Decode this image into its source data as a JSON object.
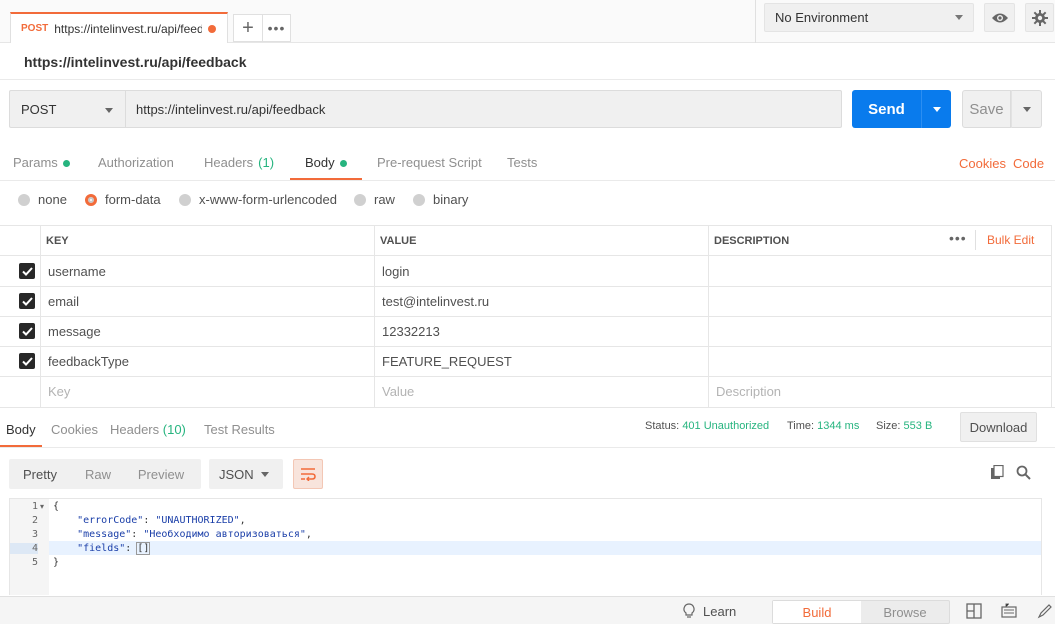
{
  "tab": {
    "method": "POST",
    "url": "https://intelinvest.ru/api/feedba"
  },
  "environment": {
    "selected": "No Environment"
  },
  "request": {
    "title": "https://intelinvest.ru/api/feedback",
    "method": "POST",
    "url": "https://intelinvest.ru/api/feedback"
  },
  "buttons": {
    "send": "Send",
    "save": "Save",
    "download": "Download"
  },
  "request_tabs": {
    "params": "Params",
    "authorization": "Authorization",
    "headers": "Headers",
    "headers_count": "(1)",
    "body": "Body",
    "prerequest": "Pre-request Script",
    "tests": "Tests",
    "cookies": "Cookies",
    "code": "Code"
  },
  "body_modes": {
    "none": "none",
    "form_data": "form-data",
    "urlencoded": "x-www-form-urlencoded",
    "raw": "raw",
    "binary": "binary",
    "selected": "form-data"
  },
  "table": {
    "headers": {
      "key": "KEY",
      "value": "VALUE",
      "description": "DESCRIPTION",
      "bulk_edit": "Bulk Edit"
    },
    "rows": [
      {
        "key": "username",
        "value": "login",
        "checked": true
      },
      {
        "key": "email",
        "value": "test@intelinvest.ru",
        "checked": true
      },
      {
        "key": "message",
        "value": "12332213",
        "checked": true
      },
      {
        "key": "feedbackType",
        "value": "FEATURE_REQUEST",
        "checked": true
      }
    ],
    "placeholders": {
      "key": "Key",
      "value": "Value",
      "description": "Description"
    }
  },
  "response_tabs": {
    "body": "Body",
    "cookies": "Cookies",
    "headers": "Headers",
    "headers_count": "(10)",
    "test_results": "Test Results"
  },
  "response_status": {
    "status_label": "Status:",
    "status_value": "401 Unauthorized",
    "time_label": "Time:",
    "time_value": "1344 ms",
    "size_label": "Size:",
    "size_value": "553 B"
  },
  "view": {
    "pretty": "Pretty",
    "raw": "Raw",
    "preview": "Preview",
    "format": "JSON"
  },
  "code": {
    "line_numbers": [
      "1",
      "2",
      "3",
      "4",
      "5"
    ],
    "l1": "{",
    "l2_key": "\"errorCode\"",
    "l2_val": "\"UNAUTHORIZED\"",
    "l3_key": "\"message\"",
    "l3_val": "\"Необходимо авторизоваться\"",
    "l4_key": "\"fields\"",
    "l4_val": "[]",
    "l5": "}"
  },
  "statusbar": {
    "learn": "Learn",
    "build": "Build",
    "browse": "Browse"
  },
  "colors": {
    "accent": "#f26b3a",
    "send": "#097bed",
    "ok": "#26b47f"
  }
}
